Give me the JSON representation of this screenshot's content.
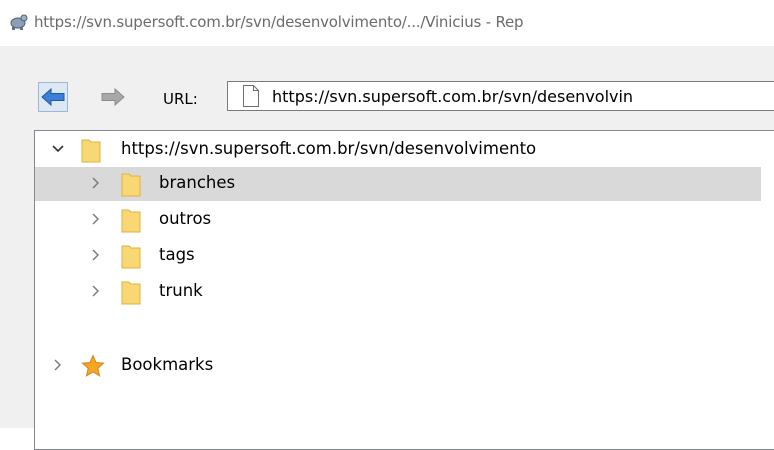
{
  "window": {
    "title": "https://svn.supersoft.com.br/svn/desenvolvimento/.../Vinicius - Rep"
  },
  "toolbar": {
    "back_icon": "back-arrow-icon",
    "forward_icon": "forward-arrow-icon",
    "url_label": "URL:",
    "url_value": "https://svn.supersoft.com.br/svn/desenvolvin"
  },
  "tree": {
    "root": {
      "label": "https://svn.supersoft.com.br/svn/desenvolvimento",
      "expanded": true,
      "icon": "folder-icon"
    },
    "children": [
      {
        "label": "branches",
        "selected": true,
        "icon": "folder-icon"
      },
      {
        "label": "outros",
        "selected": false,
        "icon": "folder-icon"
      },
      {
        "label": "tags",
        "selected": false,
        "icon": "folder-icon"
      },
      {
        "label": "trunk",
        "selected": false,
        "icon": "folder-icon"
      }
    ],
    "bookmarks": {
      "label": "Bookmarks",
      "icon": "star-icon"
    }
  },
  "colors": {
    "selection": "#d9d9d9",
    "client_bg": "#f0f0f0",
    "folder": "#f8d775",
    "back_arrow": "#3d7fd6",
    "forward_arrow": "#a8a8a8",
    "star": "#f5a623"
  }
}
